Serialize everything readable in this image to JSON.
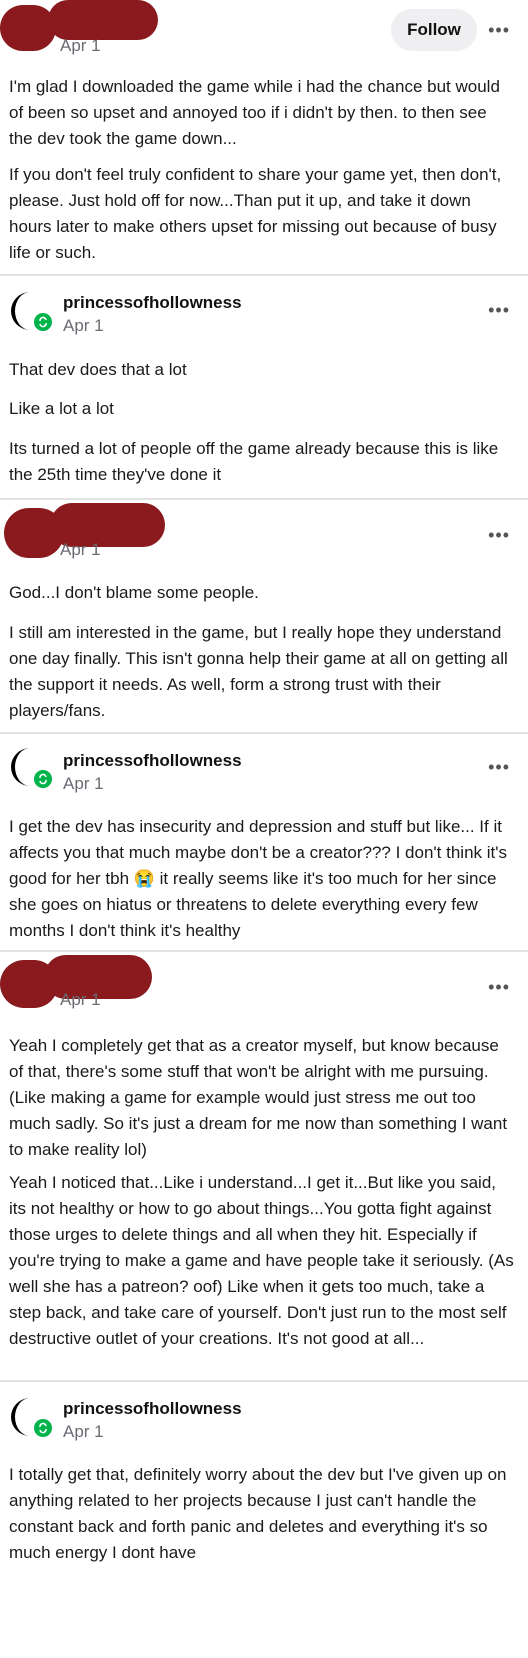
{
  "header": {
    "date": "Apr 1",
    "follow_label": "Follow",
    "more": "•••"
  },
  "posts": [
    {
      "paragraphs": [
        "I'm glad I downloaded the game while i had the chance but would of been so upset and annoyed too if i didn't by then. to then see the dev took the game down...",
        "If you don't feel truly confident to share your game yet, then don't, please. Just hold off for now...Than put it up, and take it down hours later to make others upset for missing out because of busy life or such."
      ]
    },
    {
      "username": "princessofhollowness",
      "date": "Apr 1",
      "paragraphs": [
        "That dev does that a lot",
        "Like a lot a lot",
        "Its turned a lot of people off the game already because this is like the 25th time they've done it"
      ]
    },
    {
      "date": "Apr 1",
      "paragraphs": [
        "God...I don't blame some people.",
        "I still am interested in the game, but I really hope they understand one day finally. This isn't gonna help their game at all on getting all the support it needs. As well, form a strong trust with their players/fans."
      ]
    },
    {
      "username": "princessofhollowness",
      "date": "Apr 1",
      "paragraphs": [
        "I get the dev has insecurity and depression and stuff but like... If it affects you that much maybe don't be a creator??? I don't think it's good for her tbh 😭 it really seems like it's too much for her since she goes on hiatus or threatens to delete everything every few months I don't think it's healthy"
      ]
    },
    {
      "date": "Apr 1",
      "paragraphs": [
        "Yeah I completely get that as a creator myself, but know because of that, there's some stuff that won't be alright with me pursuing. (Like making a game for example would just stress me out too much sadly. So it's just a dream for me now than something I want to make reality lol)",
        "Yeah I noticed that...Like i understand...I get it...But like you said, its not healthy or how to go about things...You gotta fight against those urges to delete things and all when they hit. Especially if you're trying to make a game and have people take it seriously. (As well she has a patreon? oof) Like when it gets too much, take a step back, and take care of yourself. Don't just run to the most self destructive outlet of your creations. It's not good at all..."
      ]
    },
    {
      "username": "princessofhollowness",
      "date": "Apr 1",
      "paragraphs": [
        "I totally get that, definitely worry about the dev but I've given up on anything related to her projects because I just can't handle the constant back and forth panic and deletes and everything it's so much energy I dont have"
      ]
    }
  ],
  "colors": {
    "reblog_green": "#00b34a",
    "redaction": "#8a1a1e",
    "meta_gray": "#6b6b73"
  },
  "icons": {
    "avatar": "crescent-moon-avatar",
    "badge": "reblog-icon",
    "more": "more-options-icon"
  }
}
